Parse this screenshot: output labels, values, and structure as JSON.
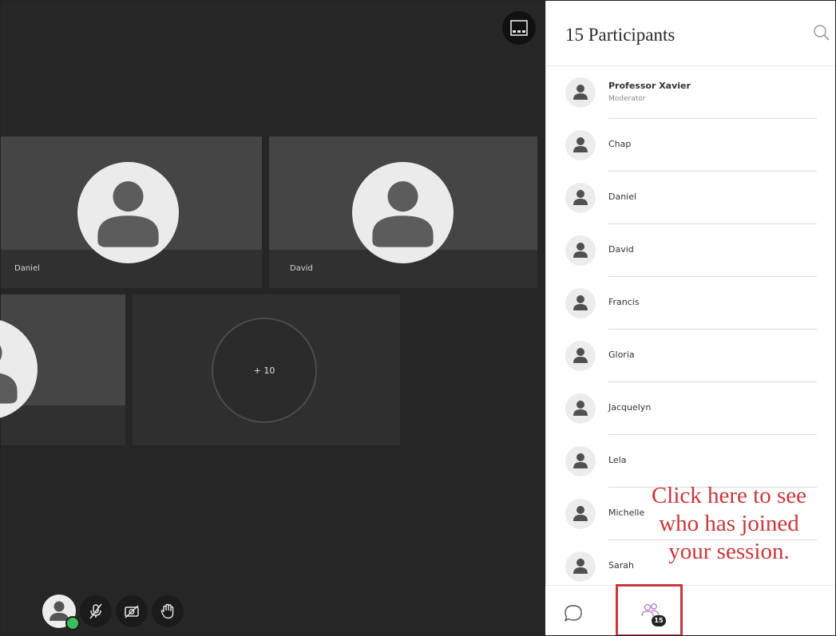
{
  "stage": {
    "tiles": [
      {
        "name": "Daniel"
      },
      {
        "name": "David"
      }
    ],
    "more_label": "+ 10"
  },
  "panel": {
    "title": "15 Participants",
    "participants": [
      {
        "name": "Professor Xavier",
        "role": "Moderator"
      },
      {
        "name": "Chap"
      },
      {
        "name": "Daniel"
      },
      {
        "name": "David"
      },
      {
        "name": "Francis"
      },
      {
        "name": "Gloria"
      },
      {
        "name": "Jacquelyn"
      },
      {
        "name": "Lela"
      },
      {
        "name": "Michelle"
      },
      {
        "name": "Sarah"
      }
    ]
  },
  "footer": {
    "attendee_count": "15"
  },
  "annotation": {
    "lines": [
      "Click here to see",
      "who has joined",
      "your session."
    ]
  },
  "colors": {
    "stage_bg": "#262626",
    "tile_bg": "#303030",
    "annotation_red": "#c8373a",
    "status_green": "#3dbd5a"
  },
  "icons": {
    "layout": "layout-icon",
    "search": "search-icon",
    "mic": "mic-off-icon",
    "camera": "camera-off-icon",
    "hand": "raise-hand-icon",
    "chat": "chat-icon",
    "attendees": "attendees-icon",
    "user": "user-icon"
  }
}
